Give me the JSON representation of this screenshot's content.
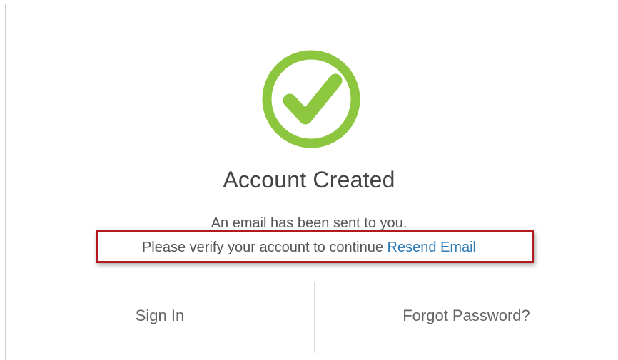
{
  "dialog": {
    "title": "Account Created",
    "message_line1": "An email has been sent to you.",
    "message_line2": "Please verify your account to continue",
    "resend_link": "Resend Email"
  },
  "footer": {
    "sign_in": "Sign In",
    "forgot_password": "Forgot Password?"
  },
  "colors": {
    "success_green": "#8dc63f",
    "link_blue": "#2a7ab8",
    "highlight_red": "#b3191f"
  },
  "icons": {
    "success": "check-circle-icon"
  }
}
